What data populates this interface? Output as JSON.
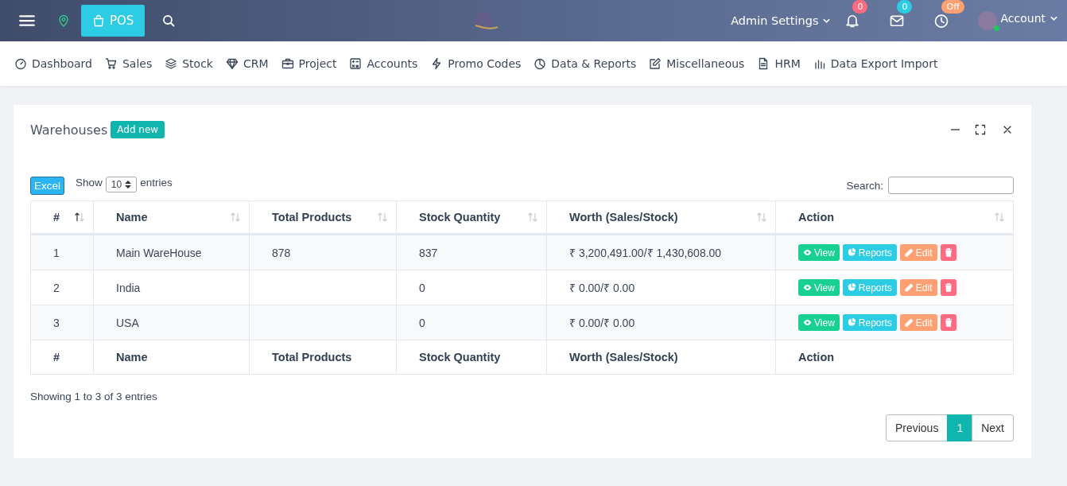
{
  "topbar": {
    "pos_button": "POS",
    "admin_settings": "Admin Settings",
    "notifications": "0",
    "messages": "0",
    "clock": "Off",
    "account": "Account"
  },
  "nav": [
    {
      "label": "Dashboard",
      "kind": "gauge"
    },
    {
      "label": "Sales",
      "kind": "cart"
    },
    {
      "label": "Stock",
      "kind": "layers"
    },
    {
      "label": "CRM",
      "kind": "diamond"
    },
    {
      "label": "Project",
      "kind": "briefcase"
    },
    {
      "label": "Accounts",
      "kind": "ledger"
    },
    {
      "label": "Promo Codes",
      "kind": "bolt"
    },
    {
      "label": "Data & Reports",
      "kind": "pie"
    },
    {
      "label": "Miscellaneous",
      "kind": "edit"
    },
    {
      "label": "HRM",
      "kind": "file"
    },
    {
      "label": "Data Export Import",
      "kind": "bars"
    }
  ],
  "card": {
    "title": "Warehouses",
    "add_button": "Add new",
    "excel_button": "Excel",
    "show_label": "Show",
    "entries_value": "10",
    "entries_label": "entries",
    "search_label": "Search:",
    "columns": [
      {
        "label": "#",
        "sorted": true
      },
      {
        "label": "Name",
        "sorted": false
      },
      {
        "label": "Total Products",
        "sorted": false
      },
      {
        "label": "Stock Quantity",
        "sorted": false
      },
      {
        "label": "Worth (Sales/Stock)",
        "sorted": false
      },
      {
        "label": "Action",
        "sorted": false
      }
    ],
    "rows": [
      {
        "cells": [
          "1",
          "Main WareHouse",
          "878",
          "837",
          "₹ 3,200,491.00/₹ 1,430,608.00"
        ],
        "actions": {
          "view": "View",
          "reports": "Reports",
          "edit": "Edit"
        }
      },
      {
        "cells": [
          "2",
          "India",
          "",
          "0",
          "₹ 0.00/₹ 0.00"
        ],
        "actions": {
          "view": "View",
          "reports": "Reports",
          "edit": "Edit"
        }
      },
      {
        "cells": [
          "3",
          "USA",
          "",
          "0",
          "₹ 0.00/₹ 0.00"
        ],
        "actions": {
          "view": "View",
          "reports": "Reports",
          "edit": "Edit"
        }
      }
    ],
    "footer_columns": [
      "#",
      "Name",
      "Total Products",
      "Stock Quantity",
      "Worth (Sales/Stock)",
      "Action"
    ],
    "info": "Showing 1 to 3 of 3 entries",
    "pagination": [
      {
        "label": "Previous",
        "selected": false
      },
      {
        "label": "1",
        "selected": true
      },
      {
        "label": "Next",
        "selected": false
      }
    ]
  }
}
